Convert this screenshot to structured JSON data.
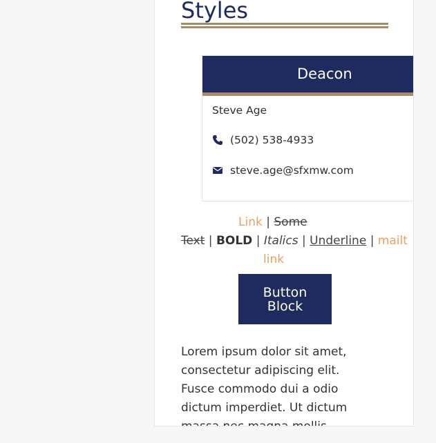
{
  "section": {
    "heading": "Styles"
  },
  "card": {
    "title": "Deacon",
    "name": "Steve Age",
    "phone": "(502) 538-4933",
    "email": "steve.age@sfxmw.com",
    "phone_icon": "phone-icon",
    "email_icon": "envelope-icon"
  },
  "styles_demo": {
    "link": "Link",
    "sep1": "|",
    "strike_part1": "Some",
    "strike_part2": "Text",
    "sep2": "|",
    "bold": "BOLD",
    "sep3": "|",
    "italics": "Italics",
    "sep4": "|",
    "underline": "Underline",
    "sep5": "|",
    "mailto_part1": "mailt",
    "mailto_part2": "link"
  },
  "button": {
    "line1": "Button",
    "line2": "Block"
  },
  "paragraph": {
    "lines": [
      "Lorem ipsum dolor sit amet,",
      "consectetur adipiscing elit.",
      "Fusce commodo dui a odio",
      "dictum imperdiet. Ut dictum",
      "massa nec magna mollis"
    ]
  },
  "colors": {
    "navy": "#1f2a5e",
    "gold": "#a88b68",
    "link": "#e8a163",
    "background": "#f7f7f7"
  }
}
